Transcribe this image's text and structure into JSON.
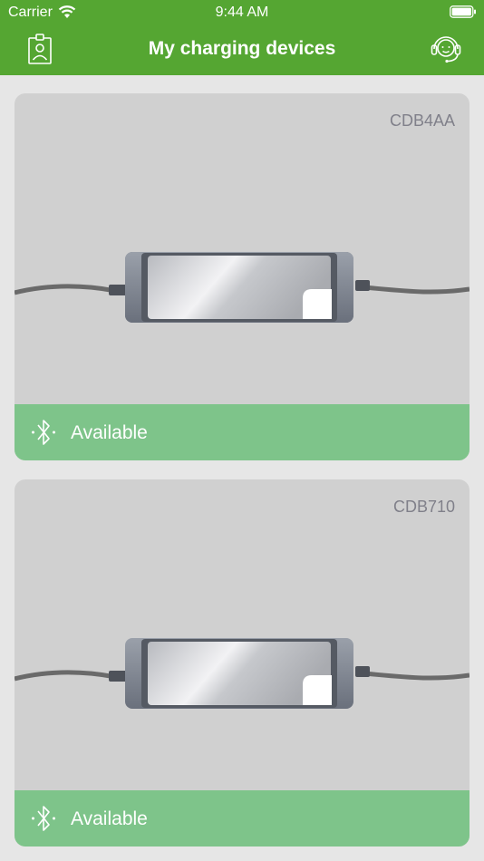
{
  "status_bar": {
    "carrier": "Carrier",
    "time": "9:44 AM"
  },
  "header": {
    "title": "My charging devices",
    "left_icon": "profile-badge-icon",
    "right_icon": "support-headset-icon"
  },
  "devices": [
    {
      "id": "CDB4AA",
      "status": "Available",
      "status_icon": "bluetooth-icon"
    },
    {
      "id": "CDB710",
      "status": "Available",
      "status_icon": "bluetooth-icon"
    }
  ],
  "colors": {
    "header_bg": "#55a632",
    "available_bg": "#7ec48a",
    "card_bg": "#d0d0d0",
    "page_bg": "#e6e6e6"
  }
}
